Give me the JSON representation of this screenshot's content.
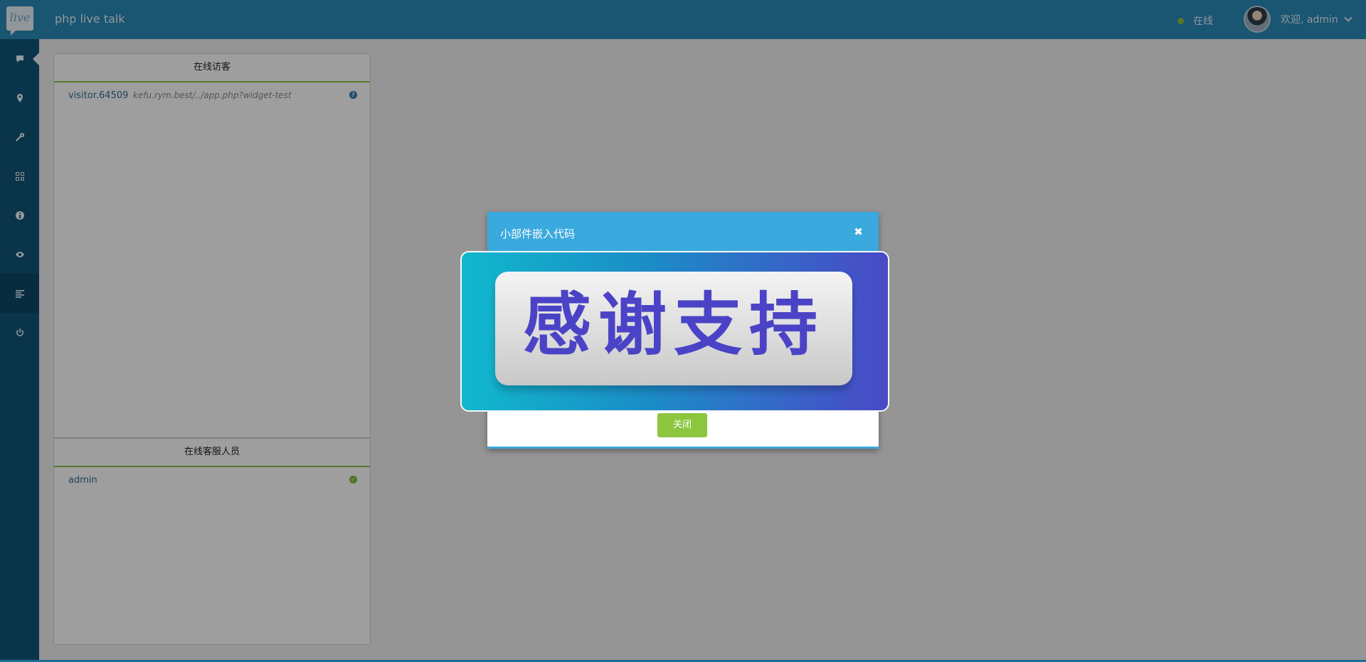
{
  "header": {
    "logo_text": "live",
    "title": "php live talk",
    "status_text": "在线",
    "welcome_text": "欢迎, admin"
  },
  "sidebar": {
    "items": [
      {
        "icon": "chat-icon"
      },
      {
        "icon": "location-pin-icon"
      },
      {
        "icon": "wrench-icon"
      },
      {
        "icon": "qrcode-icon"
      },
      {
        "icon": "info-icon"
      },
      {
        "icon": "eye-icon"
      },
      {
        "icon": "list-icon"
      },
      {
        "icon": "power-icon"
      }
    ]
  },
  "visitors_panel": {
    "title": "在线访客",
    "visitor_name": "visitor.64509",
    "visitor_url": "kefu.rym.best/../app.php?widget-test"
  },
  "staff_panel": {
    "title": "在线客服人员",
    "staff_name": "admin"
  },
  "modal": {
    "title": "小部件嵌入代码",
    "close_symbol": "✖",
    "banner_text": "感谢支持",
    "close_button_label": "关闭"
  },
  "colors": {
    "header": "#2a8ab8",
    "sidebar": "#0f5577",
    "modal_header": "#3aa9dd",
    "success": "#8cc63f"
  }
}
